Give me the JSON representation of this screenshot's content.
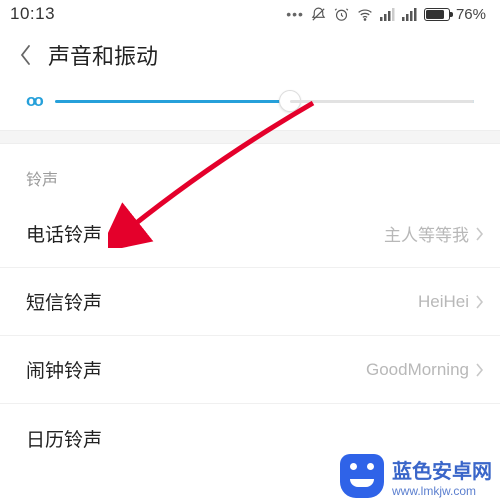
{
  "status": {
    "time": "10:13",
    "battery_percent": "76%"
  },
  "header": {
    "title": "声音和振动"
  },
  "slider": {
    "icon_label": "oo",
    "percent": 56
  },
  "section": {
    "header": "铃声",
    "items": [
      {
        "label": "电话铃声",
        "value": "主人等等我"
      },
      {
        "label": "短信铃声",
        "value": "HeiHei"
      },
      {
        "label": "闹钟铃声",
        "value": "GoodMorning"
      },
      {
        "label": "日历铃声",
        "value": ""
      }
    ]
  },
  "watermark": {
    "title": "蓝色安卓网",
    "url": "www.lmkjw.com"
  }
}
